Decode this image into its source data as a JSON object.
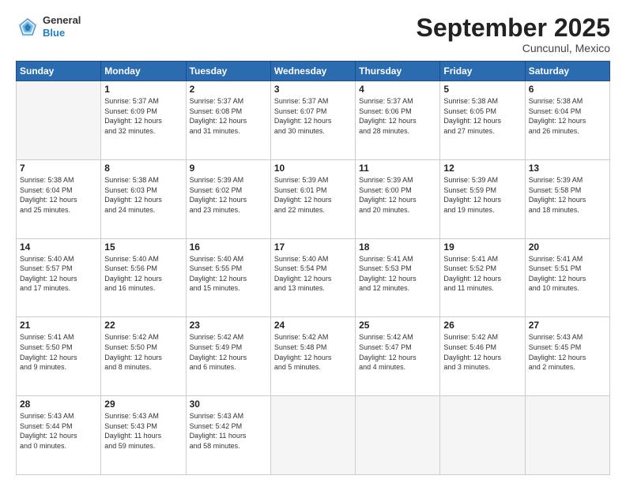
{
  "header": {
    "logo_general": "General",
    "logo_blue": "Blue",
    "month": "September 2025",
    "location": "Cuncunul, Mexico"
  },
  "days_of_week": [
    "Sunday",
    "Monday",
    "Tuesday",
    "Wednesday",
    "Thursday",
    "Friday",
    "Saturday"
  ],
  "weeks": [
    [
      {
        "day": "",
        "info": ""
      },
      {
        "day": "1",
        "info": "Sunrise: 5:37 AM\nSunset: 6:09 PM\nDaylight: 12 hours\nand 32 minutes."
      },
      {
        "day": "2",
        "info": "Sunrise: 5:37 AM\nSunset: 6:08 PM\nDaylight: 12 hours\nand 31 minutes."
      },
      {
        "day": "3",
        "info": "Sunrise: 5:37 AM\nSunset: 6:07 PM\nDaylight: 12 hours\nand 30 minutes."
      },
      {
        "day": "4",
        "info": "Sunrise: 5:37 AM\nSunset: 6:06 PM\nDaylight: 12 hours\nand 28 minutes."
      },
      {
        "day": "5",
        "info": "Sunrise: 5:38 AM\nSunset: 6:05 PM\nDaylight: 12 hours\nand 27 minutes."
      },
      {
        "day": "6",
        "info": "Sunrise: 5:38 AM\nSunset: 6:04 PM\nDaylight: 12 hours\nand 26 minutes."
      }
    ],
    [
      {
        "day": "7",
        "info": "Sunrise: 5:38 AM\nSunset: 6:04 PM\nDaylight: 12 hours\nand 25 minutes."
      },
      {
        "day": "8",
        "info": "Sunrise: 5:38 AM\nSunset: 6:03 PM\nDaylight: 12 hours\nand 24 minutes."
      },
      {
        "day": "9",
        "info": "Sunrise: 5:39 AM\nSunset: 6:02 PM\nDaylight: 12 hours\nand 23 minutes."
      },
      {
        "day": "10",
        "info": "Sunrise: 5:39 AM\nSunset: 6:01 PM\nDaylight: 12 hours\nand 22 minutes."
      },
      {
        "day": "11",
        "info": "Sunrise: 5:39 AM\nSunset: 6:00 PM\nDaylight: 12 hours\nand 20 minutes."
      },
      {
        "day": "12",
        "info": "Sunrise: 5:39 AM\nSunset: 5:59 PM\nDaylight: 12 hours\nand 19 minutes."
      },
      {
        "day": "13",
        "info": "Sunrise: 5:39 AM\nSunset: 5:58 PM\nDaylight: 12 hours\nand 18 minutes."
      }
    ],
    [
      {
        "day": "14",
        "info": "Sunrise: 5:40 AM\nSunset: 5:57 PM\nDaylight: 12 hours\nand 17 minutes."
      },
      {
        "day": "15",
        "info": "Sunrise: 5:40 AM\nSunset: 5:56 PM\nDaylight: 12 hours\nand 16 minutes."
      },
      {
        "day": "16",
        "info": "Sunrise: 5:40 AM\nSunset: 5:55 PM\nDaylight: 12 hours\nand 15 minutes."
      },
      {
        "day": "17",
        "info": "Sunrise: 5:40 AM\nSunset: 5:54 PM\nDaylight: 12 hours\nand 13 minutes."
      },
      {
        "day": "18",
        "info": "Sunrise: 5:41 AM\nSunset: 5:53 PM\nDaylight: 12 hours\nand 12 minutes."
      },
      {
        "day": "19",
        "info": "Sunrise: 5:41 AM\nSunset: 5:52 PM\nDaylight: 12 hours\nand 11 minutes."
      },
      {
        "day": "20",
        "info": "Sunrise: 5:41 AM\nSunset: 5:51 PM\nDaylight: 12 hours\nand 10 minutes."
      }
    ],
    [
      {
        "day": "21",
        "info": "Sunrise: 5:41 AM\nSunset: 5:50 PM\nDaylight: 12 hours\nand 9 minutes."
      },
      {
        "day": "22",
        "info": "Sunrise: 5:42 AM\nSunset: 5:50 PM\nDaylight: 12 hours\nand 8 minutes."
      },
      {
        "day": "23",
        "info": "Sunrise: 5:42 AM\nSunset: 5:49 PM\nDaylight: 12 hours\nand 6 minutes."
      },
      {
        "day": "24",
        "info": "Sunrise: 5:42 AM\nSunset: 5:48 PM\nDaylight: 12 hours\nand 5 minutes."
      },
      {
        "day": "25",
        "info": "Sunrise: 5:42 AM\nSunset: 5:47 PM\nDaylight: 12 hours\nand 4 minutes."
      },
      {
        "day": "26",
        "info": "Sunrise: 5:42 AM\nSunset: 5:46 PM\nDaylight: 12 hours\nand 3 minutes."
      },
      {
        "day": "27",
        "info": "Sunrise: 5:43 AM\nSunset: 5:45 PM\nDaylight: 12 hours\nand 2 minutes."
      }
    ],
    [
      {
        "day": "28",
        "info": "Sunrise: 5:43 AM\nSunset: 5:44 PM\nDaylight: 12 hours\nand 0 minutes."
      },
      {
        "day": "29",
        "info": "Sunrise: 5:43 AM\nSunset: 5:43 PM\nDaylight: 11 hours\nand 59 minutes."
      },
      {
        "day": "30",
        "info": "Sunrise: 5:43 AM\nSunset: 5:42 PM\nDaylight: 11 hours\nand 58 minutes."
      },
      {
        "day": "",
        "info": ""
      },
      {
        "day": "",
        "info": ""
      },
      {
        "day": "",
        "info": ""
      },
      {
        "day": "",
        "info": ""
      }
    ]
  ]
}
